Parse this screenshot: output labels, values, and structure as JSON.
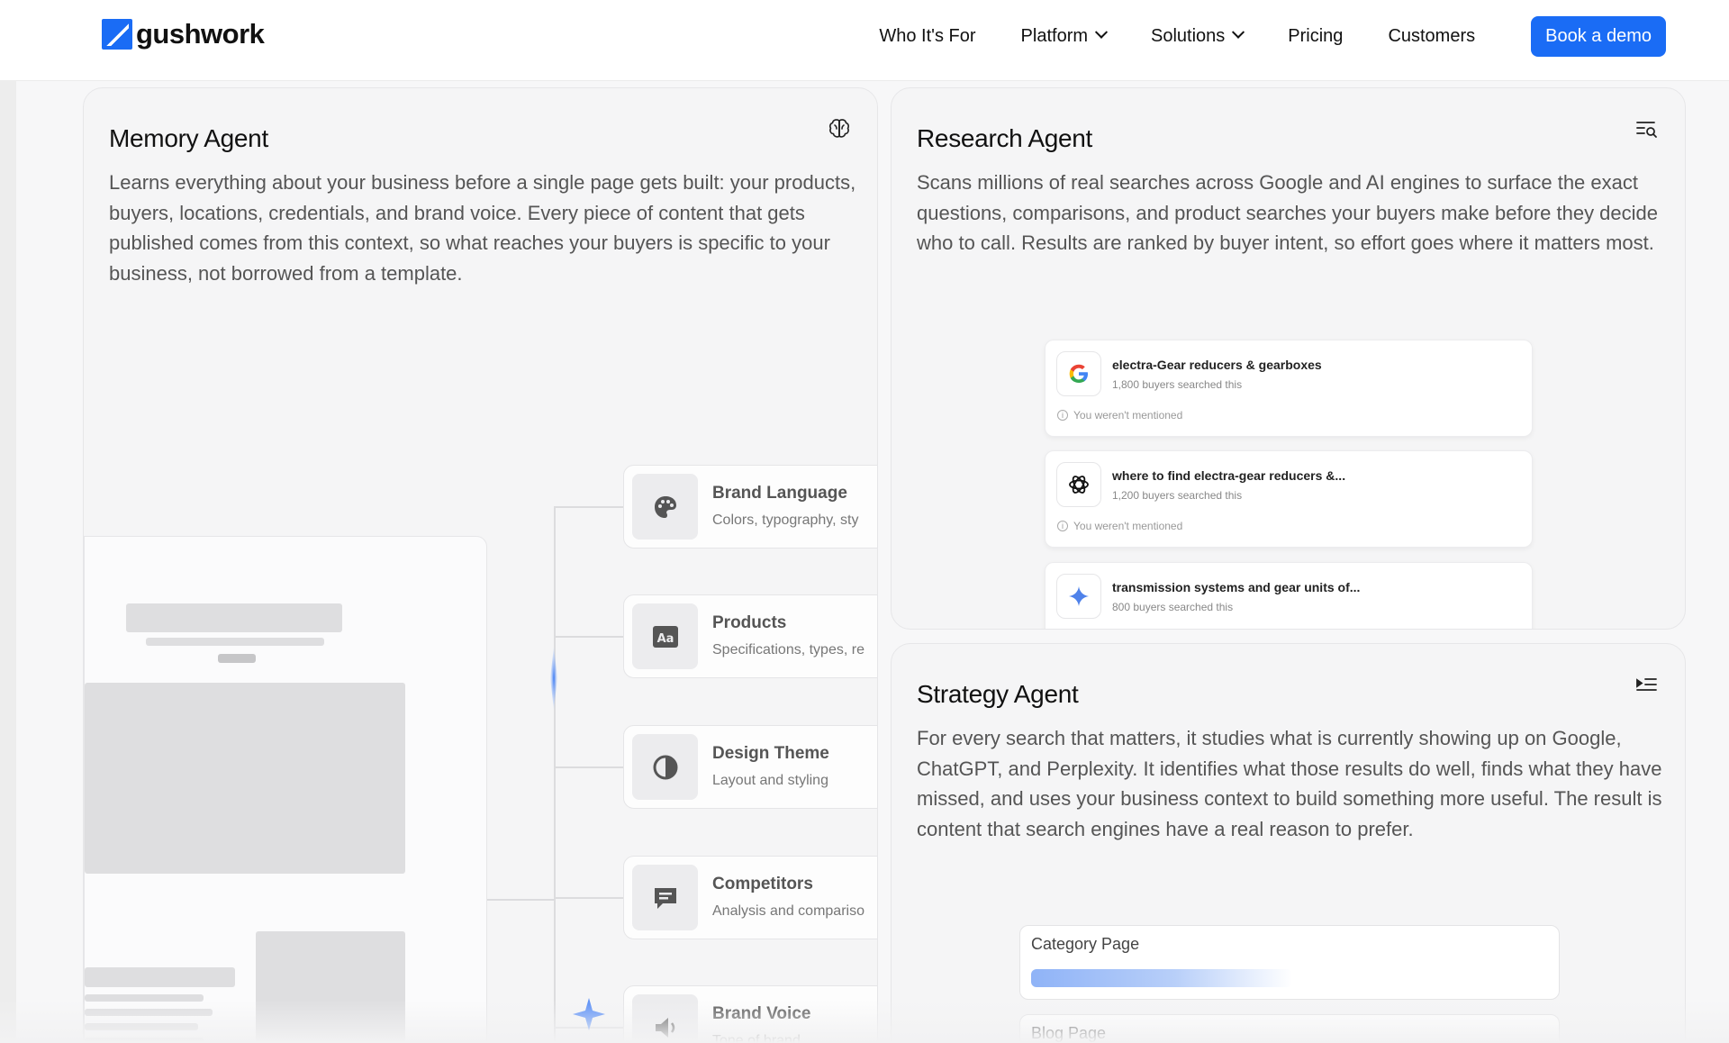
{
  "nav": {
    "brand": "gushwork",
    "links": [
      {
        "label": "Who It's For",
        "dropdown": false
      },
      {
        "label": "Platform",
        "dropdown": true
      },
      {
        "label": "Solutions",
        "dropdown": true
      },
      {
        "label": "Pricing",
        "dropdown": false
      },
      {
        "label": "Customers",
        "dropdown": false
      }
    ],
    "cta": "Book a demo",
    "accent": "#1a6cf5"
  },
  "memory": {
    "title": "Memory Agent",
    "icon": "brain-icon",
    "description": "Learns everything about your business before a single page gets built: your products, buyers, locations, credentials, and brand voice. Every piece of content that gets published comes from this context, so what reaches your buyers is specific to your business, not borrowed from a template.",
    "nodes": [
      {
        "title": "Brand Language",
        "subtitle": "Colors, typography, sty",
        "icon": "palette-icon"
      },
      {
        "title": "Products",
        "subtitle": "Specifications, types, re",
        "icon": "font-icon"
      },
      {
        "title": "Design Theme",
        "subtitle": "Layout and styling",
        "icon": "contrast-icon"
      },
      {
        "title": "Competitors",
        "subtitle": "Analysis and compariso",
        "icon": "comment-icon"
      },
      {
        "title": "Brand Voice",
        "subtitle": "Tone of brand",
        "icon": "speaker-icon"
      }
    ]
  },
  "research": {
    "title": "Research Agent",
    "icon": "search-list-icon",
    "description": "Scans millions of real searches across Google and AI engines to surface the exact questions, comparisons, and product searches your buyers make before they decide who to call. Results are ranked by buyer intent, so effort goes where it matters most.",
    "results": [
      {
        "engine": "google-icon",
        "query": "electra-Gear reducers & gearboxes",
        "volume": "1,800 buyers searched this",
        "note": "You weren't mentioned"
      },
      {
        "engine": "chatgpt-icon",
        "query": "where to find electra-gear reducers &...",
        "volume": "1,200 buyers searched this",
        "note": "You weren't mentioned"
      },
      {
        "engine": "gemini-icon",
        "query": "transmission systems and gear units of...",
        "volume": "800 buyers searched this",
        "note": ""
      }
    ]
  },
  "strategy": {
    "title": "Strategy Agent",
    "icon": "indent-list-icon",
    "description": "For every search that matters, it studies what is currently showing up on Google, ChatGPT, and Perplexity. It identifies what those results do well, finds what they have missed, and uses your business context to build something more useful. The result is content that search engines have a real reason to prefer.",
    "pages": [
      {
        "label": "Category Page"
      },
      {
        "label": "Blog Page"
      }
    ]
  }
}
